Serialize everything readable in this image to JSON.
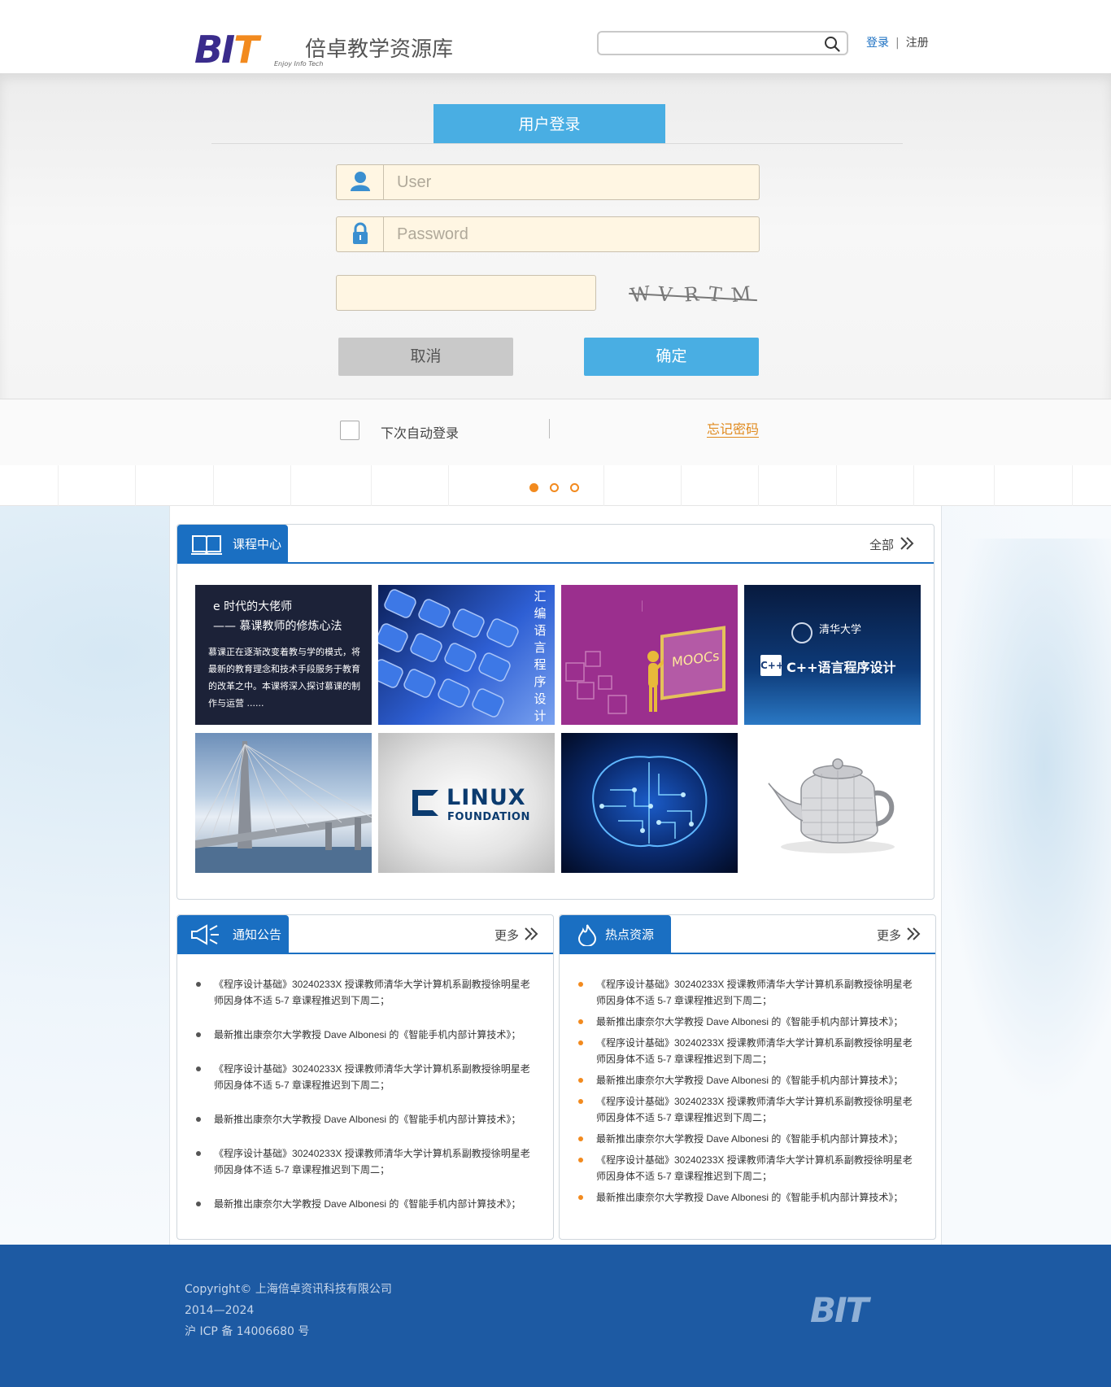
{
  "header": {
    "logo_text_part1": "BI",
    "logo_text_part2": "T",
    "logo_tagline": "Enjoy Info Tech",
    "site_name": "倍卓教学资源库",
    "search": {
      "value": "",
      "placeholder": ""
    },
    "login_link": "登录",
    "register_link": "注册",
    "icons": {
      "search": "search-icon"
    }
  },
  "login": {
    "tab_title": "用户登录",
    "username_placeholder": "User",
    "password_placeholder": "Password",
    "captcha_value": "",
    "captcha_text": [
      "W",
      "V",
      "R",
      "T",
      "M"
    ],
    "cancel_label": "取消",
    "confirm_label": "确定",
    "remember_label": "下次自动登录",
    "remember_checked": false,
    "forgot_label": "忘记密码",
    "colors": {
      "accent": "#49aee3",
      "field_bg": "#fff6e3",
      "link": "#e08a1e"
    },
    "icons": {
      "user": "user-icon",
      "lock": "lock-icon"
    }
  },
  "carousel": {
    "slide_count": 3,
    "active_index": 0
  },
  "courses": {
    "title": "课程中心",
    "all_label": "全部",
    "tiles": [
      {
        "kind": "text",
        "title": "e 时代的大佬师",
        "subtitle": "—— 慕课教师的修炼心法",
        "desc": "慕课正在逐渐改变着教与学的模式，将最新的教育理念和技术手段服务于教育的改革之中。本课将深入探讨慕课的制作与运营 ......"
      },
      {
        "kind": "keyboard",
        "vertical_text": "汇编语言程序设计"
      },
      {
        "kind": "moocs",
        "board_text": "MOOCs"
      },
      {
        "kind": "tsinghua",
        "univ": "清华大学",
        "badge": "C++",
        "title": "C++语言程序设计"
      },
      {
        "kind": "bridge"
      },
      {
        "kind": "linux",
        "line1": "LINUX",
        "line2": "FOUNDATION"
      },
      {
        "kind": "brain"
      },
      {
        "kind": "teapot"
      }
    ]
  },
  "notice": {
    "title": "通知公告",
    "more_label": "更多",
    "items": [
      "《程序设计基础》30240233X 授课教师清华大学计算机系副教授徐明星老师因身体不适 5-7 章课程推迟到下周二；",
      "最新推出康奈尔大学教授 Dave Albonesi 的《智能手机内部计算技术》；",
      "《程序设计基础》30240233X 授课教师清华大学计算机系副教授徐明星老师因身体不适 5-7 章课程推迟到下周二；",
      "最新推出康奈尔大学教授 Dave Albonesi 的《智能手机内部计算技术》；",
      "《程序设计基础》30240233X 授课教师清华大学计算机系副教授徐明星老师因身体不适 5-7 章课程推迟到下周二；",
      "最新推出康奈尔大学教授 Dave Albonesi 的《智能手机内部计算技术》；"
    ]
  },
  "hot": {
    "title": "热点资源",
    "more_label": "更多",
    "items": [
      "《程序设计基础》30240233X 授课教师清华大学计算机系副教授徐明星老师因身体不适 5-7 章课程推迟到下周二；",
      "最新推出康奈尔大学教授 Dave Albonesi 的《智能手机内部计算技术》；",
      "《程序设计基础》30240233X 授课教师清华大学计算机系副教授徐明星老师因身体不适 5-7 章课程推迟到下周二；",
      "最新推出康奈尔大学教授 Dave Albonesi 的《智能手机内部计算技术》；",
      "《程序设计基础》30240233X 授课教师清华大学计算机系副教授徐明星老师因身体不适 5-7 章课程推迟到下周二；",
      "最新推出康奈尔大学教授 Dave Albonesi 的《智能手机内部计算技术》；",
      "《程序设计基础》30240233X 授课教师清华大学计算机系副教授徐明星老师因身体不适 5-7 章课程推迟到下周二；",
      "最新推出康奈尔大学教授 Dave Albonesi 的《智能手机内部计算技术》；"
    ]
  },
  "footer": {
    "copyright": "Copyright© 上海倍卓资讯科技有限公司",
    "years": "2014—2024",
    "icp": "沪 ICP 备 14006680 号",
    "logo_text": "BIT"
  }
}
